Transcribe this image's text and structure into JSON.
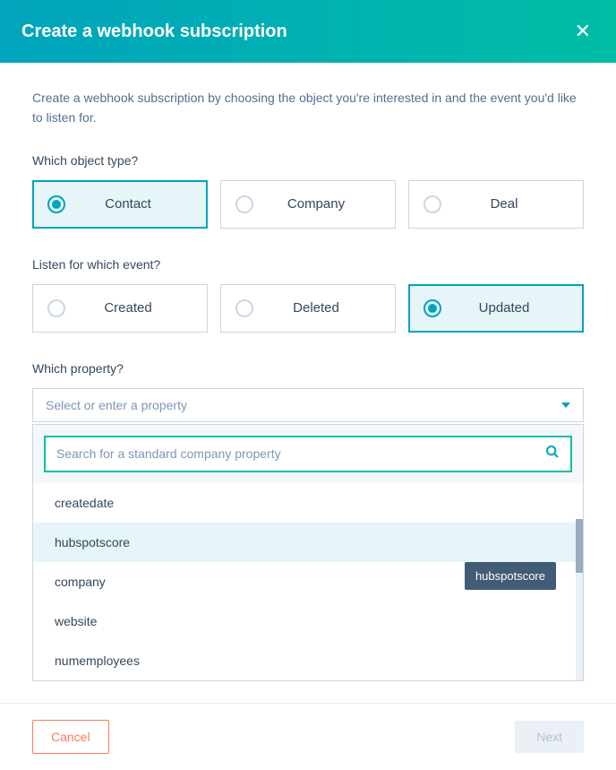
{
  "header": {
    "title": "Create a webhook subscription"
  },
  "description": "Create a webhook subscription by choosing the object you're interested in and the event you'd like to listen for.",
  "objectType": {
    "label": "Which object type?",
    "options": [
      {
        "label": "Contact",
        "selected": true
      },
      {
        "label": "Company",
        "selected": false
      },
      {
        "label": "Deal",
        "selected": false
      }
    ]
  },
  "event": {
    "label": "Listen for which event?",
    "options": [
      {
        "label": "Created",
        "selected": false
      },
      {
        "label": "Deleted",
        "selected": false
      },
      {
        "label": "Updated",
        "selected": true
      }
    ]
  },
  "property": {
    "label": "Which property?",
    "placeholder": "Select or enter a property",
    "searchPlaceholder": "Search for a standard company property",
    "options": [
      {
        "label": "createdate",
        "hover": false
      },
      {
        "label": "hubspotscore",
        "hover": true
      },
      {
        "label": "company",
        "hover": false
      },
      {
        "label": "website",
        "hover": false
      },
      {
        "label": "numemployees",
        "hover": false
      }
    ],
    "tooltip": "hubspotscore"
  },
  "footer": {
    "cancel": "Cancel",
    "next": "Next"
  }
}
